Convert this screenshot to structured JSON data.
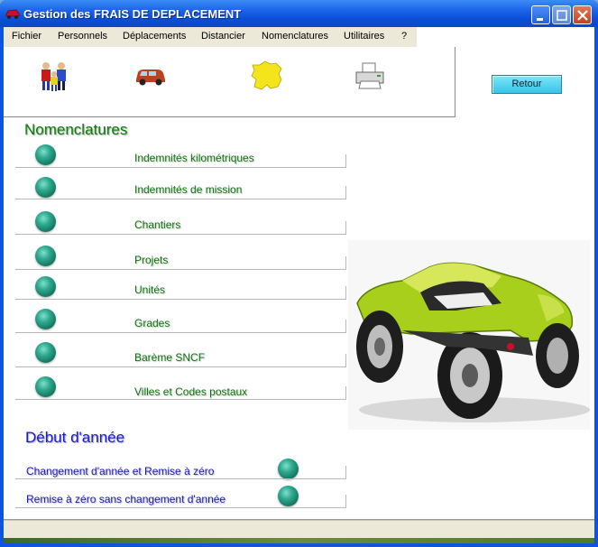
{
  "window": {
    "title": "Gestion des FRAIS DE DEPLACEMENT"
  },
  "menu": {
    "items": [
      "Fichier",
      "Personnels",
      "Déplacements",
      "Distancier",
      "Nomenclatures",
      "Utilitaires",
      "?"
    ]
  },
  "toolbar": {
    "icons": [
      "personnel-icon",
      "car-icon",
      "france-map-icon",
      "printer-icon"
    ]
  },
  "retour_label": "Retour",
  "nomenclatures": {
    "title": "Nomenclatures",
    "items": [
      "Indemnités kilométriques",
      "Indemnités de mission",
      "Chantiers",
      "Projets",
      "Unités",
      "Grades",
      "Barème SNCF",
      "Villes et Codes postaux"
    ]
  },
  "debut_annee": {
    "title": "Début d'année",
    "items": [
      "Changement d'année et Remise à zéro",
      "Remise à zéro sans changement d'année"
    ]
  },
  "colors": {
    "title_bar": "#0a4fd8",
    "green_label": "#177017",
    "blue_label": "#1b1bb0",
    "teal_button": "#2fa890"
  }
}
